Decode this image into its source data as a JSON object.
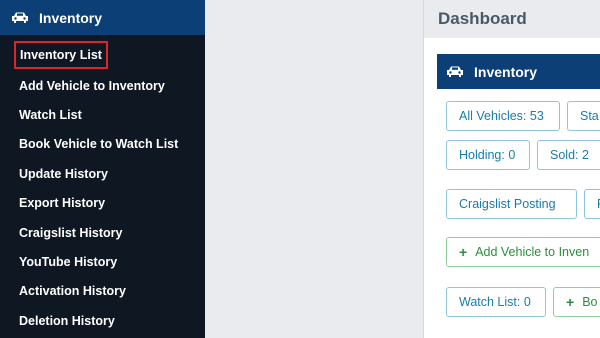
{
  "sidebar": {
    "title": "Inventory",
    "icon": "car-icon",
    "items": [
      {
        "label": "Inventory List",
        "active": true
      },
      {
        "label": "Add Vehicle to Inventory"
      },
      {
        "label": "Watch List"
      },
      {
        "label": "Book Vehicle to Watch List"
      },
      {
        "label": "Update History"
      },
      {
        "label": "Export History"
      },
      {
        "label": "Craigslist History"
      },
      {
        "label": "YouTube History"
      },
      {
        "label": "Activation History"
      },
      {
        "label": "Deletion History"
      }
    ]
  },
  "dashboard": {
    "title": "Dashboard",
    "panel_title": "Inventory",
    "buttons": {
      "all_vehicles": "All Vehicles: 53",
      "sta": "Sta",
      "holding": "Holding: 0",
      "sold": "Sold: 2",
      "craigslist": "Craigslist Posting",
      "f": "F",
      "add_vehicle": "Add Vehicle to Inven",
      "watch_list": "Watch List: 0",
      "bo": "Bo"
    }
  },
  "colors": {
    "sidebar_bg": "#0f1722",
    "header_blue": "#0b3f75",
    "highlight_red": "#d9252b",
    "button_blue": "#177ea8",
    "button_green": "#2a8f3d"
  }
}
